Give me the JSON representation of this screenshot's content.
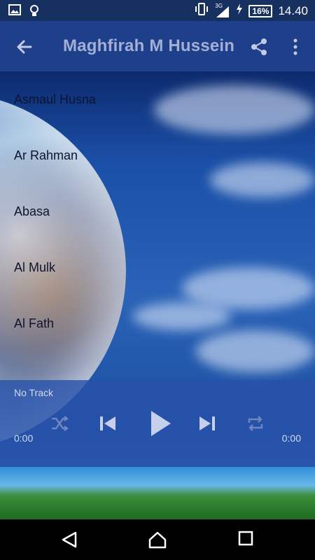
{
  "status_bar": {
    "network_label": "3G",
    "battery": "16%",
    "time": "14.40",
    "icons": [
      "image-icon",
      "lightbulb-icon",
      "vibrate-icon",
      "signal-icon",
      "charging-icon",
      "battery-icon"
    ]
  },
  "app_bar": {
    "title": "Maghfirah M Hussein",
    "icons": [
      "back-arrow-icon",
      "share-icon",
      "more-vert-icon"
    ]
  },
  "tracks": [
    {
      "label": "Asmaul Husna"
    },
    {
      "label": "Ar Rahman"
    },
    {
      "label": "Abasa"
    },
    {
      "label": "Al Mulk"
    },
    {
      "label": "Al Fath"
    }
  ],
  "player": {
    "now_playing": "No Track",
    "elapsed": "0:00",
    "duration": "0:00",
    "controls": [
      "shuffle-icon",
      "skip-previous-icon",
      "play-icon",
      "skip-next-icon",
      "repeat-icon"
    ]
  },
  "nav": {
    "icons": [
      "nav-back-icon",
      "nav-home-icon",
      "nav-recents-icon"
    ]
  }
}
